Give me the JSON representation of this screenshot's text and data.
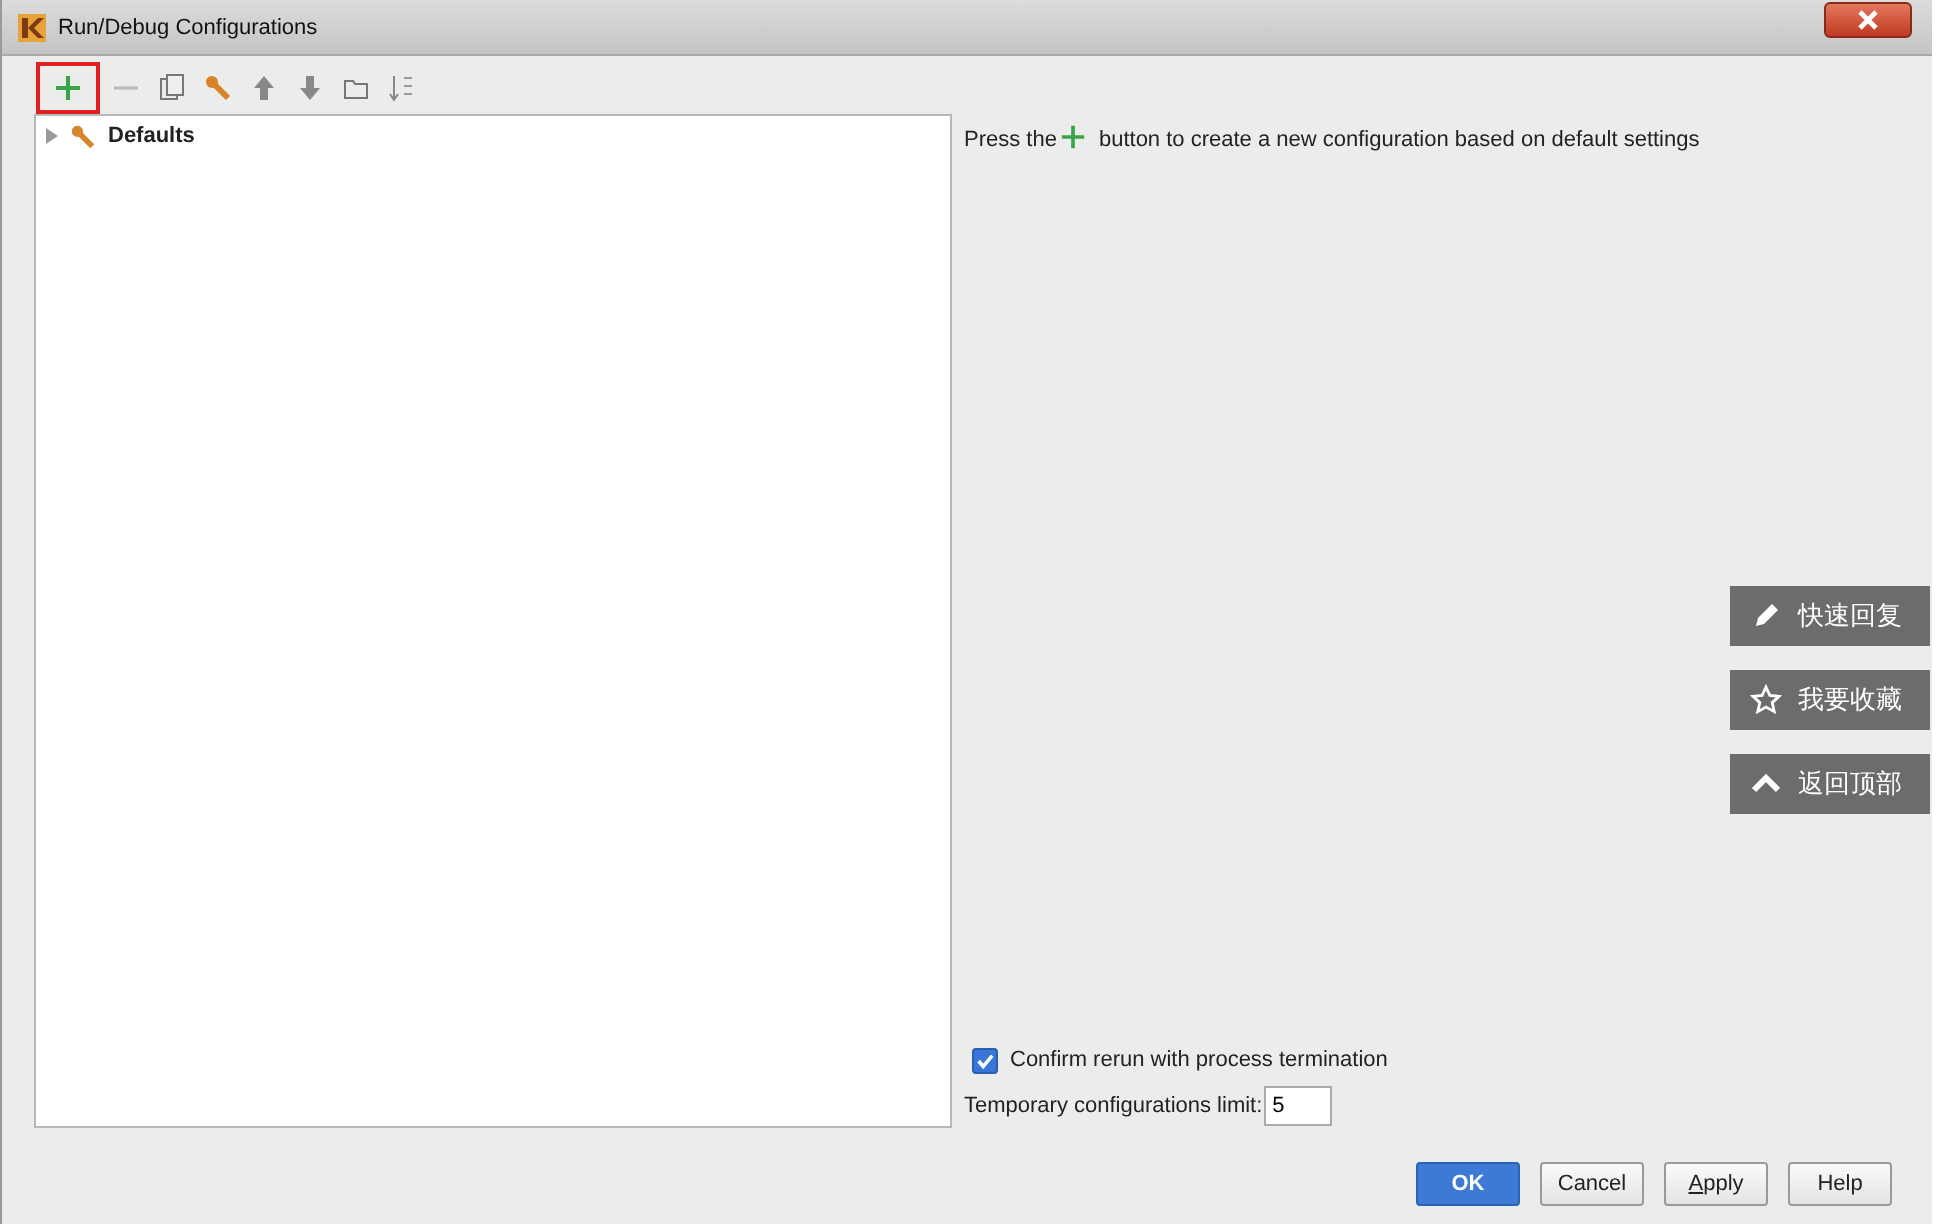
{
  "window": {
    "title": "Run/Debug Configurations"
  },
  "toolbar": [
    {
      "kind": "add",
      "highlighted": true,
      "disabled": false
    },
    {
      "kind": "remove",
      "highlighted": false,
      "disabled": true
    },
    {
      "kind": "copy",
      "highlighted": false,
      "disabled": false
    },
    {
      "kind": "edit-defaults",
      "highlighted": false,
      "disabled": false
    },
    {
      "kind": "up",
      "highlighted": false,
      "disabled": false
    },
    {
      "kind": "down",
      "highlighted": false,
      "disabled": false
    },
    {
      "kind": "folder",
      "highlighted": false,
      "disabled": false
    },
    {
      "kind": "sort",
      "highlighted": false,
      "disabled": false
    }
  ],
  "tree": [
    {
      "label": "Defaults",
      "expanded": false
    }
  ],
  "hint": {
    "before": "Press the",
    "after": "button to create a new configuration based on default settings"
  },
  "confirm_rerun": {
    "label": "Confirm rerun with process termination",
    "checked": true
  },
  "temp_limit": {
    "label": "Temporary configurations limit:",
    "value": "5"
  },
  "buttons": [
    {
      "label": "OK",
      "primary": true,
      "mnemonic": false
    },
    {
      "label": "Cancel",
      "primary": false,
      "mnemonic": false
    },
    {
      "label": "Apply",
      "primary": false,
      "mnemonic": true
    },
    {
      "label": "Help",
      "primary": false,
      "mnemonic": false
    }
  ],
  "side_buttons": [
    {
      "kind": "pencil",
      "label": "快速回复"
    },
    {
      "kind": "star",
      "label": "我要收藏"
    },
    {
      "kind": "up",
      "label": "返回顶部"
    }
  ]
}
